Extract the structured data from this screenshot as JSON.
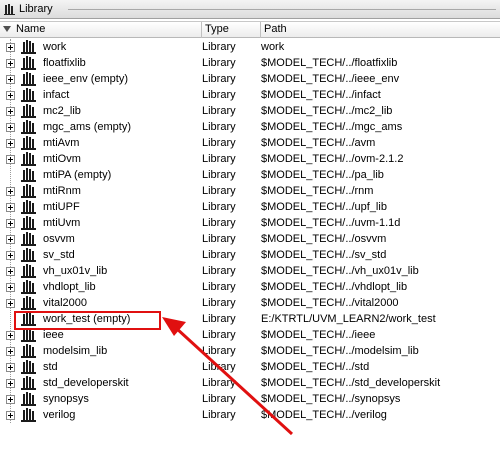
{
  "panel": {
    "title": "Library"
  },
  "columns": {
    "name": "Name",
    "type": "Type",
    "path": "Path"
  },
  "rows": [
    {
      "name": "work",
      "type": "Library",
      "path": "work",
      "expandable": true
    },
    {
      "name": "floatfixlib",
      "type": "Library",
      "path": "$MODEL_TECH/../floatfixlib",
      "expandable": true
    },
    {
      "name": "ieee_env  (empty)",
      "type": "Library",
      "path": "$MODEL_TECH/../ieee_env",
      "expandable": true
    },
    {
      "name": "infact",
      "type": "Library",
      "path": "$MODEL_TECH/../infact",
      "expandable": true
    },
    {
      "name": "mc2_lib",
      "type": "Library",
      "path": "$MODEL_TECH/../mc2_lib",
      "expandable": true
    },
    {
      "name": "mgc_ams  (empty)",
      "type": "Library",
      "path": "$MODEL_TECH/../mgc_ams",
      "expandable": true
    },
    {
      "name": "mtiAvm",
      "type": "Library",
      "path": "$MODEL_TECH/../avm",
      "expandable": true
    },
    {
      "name": "mtiOvm",
      "type": "Library",
      "path": "$MODEL_TECH/../ovm-2.1.2",
      "expandable": true
    },
    {
      "name": "mtiPA  (empty)",
      "type": "Library",
      "path": "$MODEL_TECH/../pa_lib",
      "expandable": false
    },
    {
      "name": "mtiRnm",
      "type": "Library",
      "path": "$MODEL_TECH/../rnm",
      "expandable": true
    },
    {
      "name": "mtiUPF",
      "type": "Library",
      "path": "$MODEL_TECH/../upf_lib",
      "expandable": true
    },
    {
      "name": "mtiUvm",
      "type": "Library",
      "path": "$MODEL_TECH/../uvm-1.1d",
      "expandable": true
    },
    {
      "name": "osvvm",
      "type": "Library",
      "path": "$MODEL_TECH/../osvvm",
      "expandable": true
    },
    {
      "name": "sv_std",
      "type": "Library",
      "path": "$MODEL_TECH/../sv_std",
      "expandable": true
    },
    {
      "name": "vh_ux01v_lib",
      "type": "Library",
      "path": "$MODEL_TECH/../vh_ux01v_lib",
      "expandable": true
    },
    {
      "name": "vhdlopt_lib",
      "type": "Library",
      "path": "$MODEL_TECH/../vhdlopt_lib",
      "expandable": true
    },
    {
      "name": "vital2000",
      "type": "Library",
      "path": "$MODEL_TECH/../vital2000",
      "expandable": true
    },
    {
      "name": "work_test  (empty)",
      "type": "Library",
      "path": "E:/KTRTL/UVM_LEARN2/work_test",
      "expandable": false
    },
    {
      "name": "ieee",
      "type": "Library",
      "path": "$MODEL_TECH/../ieee",
      "expandable": true
    },
    {
      "name": "modelsim_lib",
      "type": "Library",
      "path": "$MODEL_TECH/../modelsim_lib",
      "expandable": true
    },
    {
      "name": "std",
      "type": "Library",
      "path": "$MODEL_TECH/../std",
      "expandable": true
    },
    {
      "name": "std_developerskit",
      "type": "Library",
      "path": "$MODEL_TECH/../std_developerskit",
      "expandable": true
    },
    {
      "name": "synopsys",
      "type": "Library",
      "path": "$MODEL_TECH/../synopsys",
      "expandable": true
    },
    {
      "name": "verilog",
      "type": "Library",
      "path": "$MODEL_TECH/../verilog",
      "expandable": true
    }
  ],
  "annotation": {
    "color": "#e01010",
    "highlighted_row": "work_test  (empty)"
  }
}
